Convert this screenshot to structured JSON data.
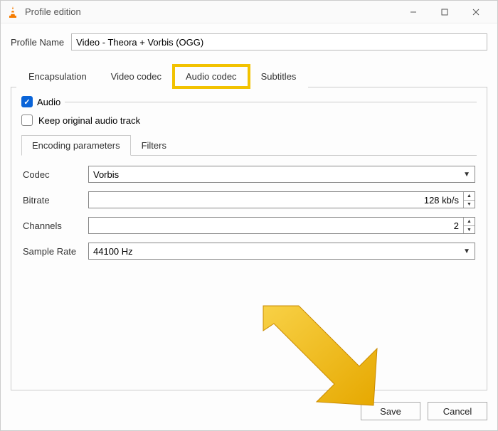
{
  "title": "Profile edition",
  "profile": {
    "label": "Profile Name",
    "value": "Video - Theora + Vorbis (OGG)"
  },
  "tabs": {
    "encapsulation": "Encapsulation",
    "video_codec": "Video codec",
    "audio_codec": "Audio codec",
    "subtitles": "Subtitles"
  },
  "audio": {
    "checkbox_label": "Audio",
    "keep_original": "Keep original audio track"
  },
  "subtabs": {
    "encoding": "Encoding parameters",
    "filters": "Filters"
  },
  "fields": {
    "codec_label": "Codec",
    "codec_value": "Vorbis",
    "bitrate_label": "Bitrate",
    "bitrate_value": "128 kb/s",
    "channels_label": "Channels",
    "channels_value": "2",
    "samplerate_label": "Sample Rate",
    "samplerate_value": "44100 Hz"
  },
  "buttons": {
    "save": "Save",
    "cancel": "Cancel"
  }
}
